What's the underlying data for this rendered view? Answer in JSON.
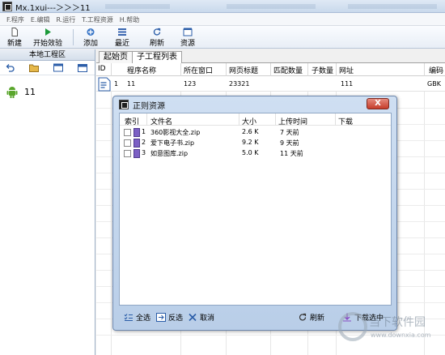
{
  "window": {
    "title": "Mx.1xui---＞＞＞11"
  },
  "menu": {
    "items": [
      "F.程序",
      "E.编辑",
      "R.运行",
      "T.工程资源",
      "H.帮助"
    ]
  },
  "toolbar": {
    "new_label": "新建",
    "start_label": "开始效验",
    "add_label": "添加",
    "recent_label": "最近",
    "refresh_label": "刷新",
    "resource_label": "资源"
  },
  "left_panel": {
    "title": "本地工程区",
    "project_name": "11"
  },
  "tabs": {
    "home": "起始页",
    "subprojects": "子工程列表"
  },
  "grid": {
    "headers": [
      "ID",
      "程序名称",
      "所在窗口",
      "网页标题",
      "匹配数量",
      "子数量",
      "网址",
      "编码"
    ],
    "row": {
      "id": "1",
      "name": "11",
      "window": "123",
      "page_title": "23321",
      "match": "",
      "count": "",
      "url": "111",
      "encoding": "GBK"
    }
  },
  "dialog": {
    "title": "正则资源",
    "close_label": "X",
    "columns": [
      "索引",
      "文件名",
      "大小",
      "上传时间",
      "下载"
    ],
    "files": [
      {
        "index": "1",
        "name": "360影视大全.zip",
        "size": "2.6 K",
        "time": "7 天前"
      },
      {
        "index": "2",
        "name": "爱下电子书.zip",
        "size": "9.2 K",
        "time": "9 天前"
      },
      {
        "index": "3",
        "name": "如意图库.zip",
        "size": "5.0 K",
        "time": "11 天前"
      }
    ],
    "buttons": {
      "select_all": "全选",
      "invert": "反选",
      "cancel": "取消",
      "refresh": "刷新",
      "download_selected": "下载选中"
    }
  },
  "watermark": {
    "text": "当下软件园",
    "url": "www.downxia.com"
  }
}
